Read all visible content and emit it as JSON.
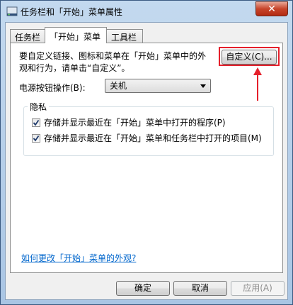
{
  "window": {
    "title": "任务栏和「开始」菜单属性",
    "close_label": "✕"
  },
  "tabs": [
    {
      "label": "任务栏"
    },
    {
      "label": "「开始」菜单"
    },
    {
      "label": "工具栏"
    }
  ],
  "start_menu": {
    "description": "要自定义链接、图标和菜单在「开始」菜单中的外观和行为，请单击“自定义”。",
    "customize_button": "自定义(C)...",
    "power_label": "电源按钮操作(B):",
    "power_selected": "关机",
    "privacy_group_label": "隐私",
    "privacy_options": [
      {
        "label": "存储并显示最近在「开始」菜单中打开的程序(P)",
        "checked": true
      },
      {
        "label": "存储并显示最近在「开始」菜单和任务栏中打开的项目(M)",
        "checked": true
      }
    ],
    "help_link": "如何更改「开始」菜单的外观?"
  },
  "footer": {
    "ok": "确定",
    "cancel": "取消",
    "apply": "应用(A)"
  },
  "annotation": {
    "highlight_color": "#e5202b"
  }
}
